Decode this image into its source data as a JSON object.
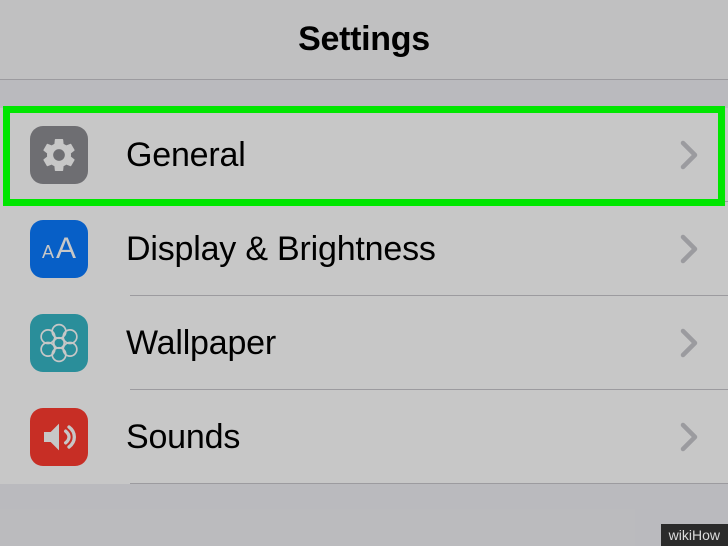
{
  "header": {
    "title": "Settings"
  },
  "rows": [
    {
      "id": "general",
      "label": "General"
    },
    {
      "id": "display",
      "label": "Display & Brightness"
    },
    {
      "id": "wallpaper",
      "label": "Wallpaper"
    },
    {
      "id": "sounds",
      "label": "Sounds"
    }
  ],
  "watermark": "wikiHow",
  "highlight_row": "general"
}
